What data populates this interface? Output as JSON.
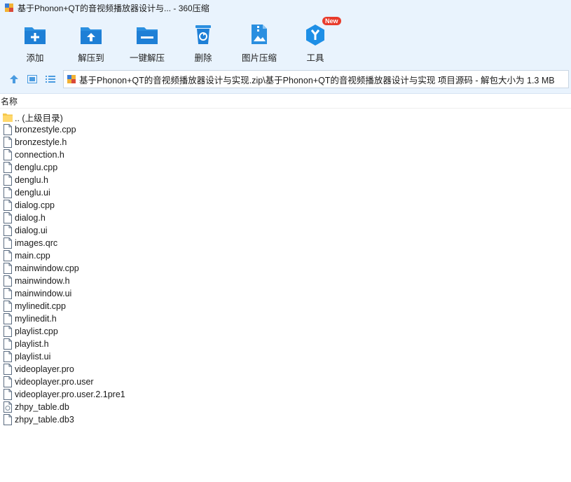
{
  "window": {
    "title": "基于Phonon+QT的音视频播放器设计与... - 360压缩"
  },
  "toolbar": {
    "items": [
      {
        "label": "添加",
        "icon": "add-icon"
      },
      {
        "label": "解压到",
        "icon": "extract-to-icon"
      },
      {
        "label": "一键解压",
        "icon": "one-click-extract-icon"
      },
      {
        "label": "删除",
        "icon": "delete-icon"
      },
      {
        "label": "图片压缩",
        "icon": "image-compress-icon"
      },
      {
        "label": "工具",
        "icon": "tools-icon",
        "badge": "New"
      }
    ]
  },
  "address": {
    "path": "基于Phonon+QT的音视频播放器设计与实现.zip\\基于Phonon+QT的音视频播放器设计与实现 项目源码 - 解包大小为 1.3 MB"
  },
  "list": {
    "header": "名称",
    "parent": ".. (上级目录)",
    "files": [
      {
        "name": "bronzestyle.cpp",
        "type": "file"
      },
      {
        "name": "bronzestyle.h",
        "type": "file"
      },
      {
        "name": "connection.h",
        "type": "file"
      },
      {
        "name": "denglu.cpp",
        "type": "file"
      },
      {
        "name": "denglu.h",
        "type": "file"
      },
      {
        "name": "denglu.ui",
        "type": "file"
      },
      {
        "name": "dialog.cpp",
        "type": "file"
      },
      {
        "name": "dialog.h",
        "type": "file"
      },
      {
        "name": "dialog.ui",
        "type": "file"
      },
      {
        "name": "images.qrc",
        "type": "file"
      },
      {
        "name": "main.cpp",
        "type": "file"
      },
      {
        "name": "mainwindow.cpp",
        "type": "file"
      },
      {
        "name": "mainwindow.h",
        "type": "file"
      },
      {
        "name": "mainwindow.ui",
        "type": "file"
      },
      {
        "name": "mylinedit.cpp",
        "type": "file"
      },
      {
        "name": "mylinedit.h",
        "type": "file"
      },
      {
        "name": "playlist.cpp",
        "type": "file"
      },
      {
        "name": "playlist.h",
        "type": "file"
      },
      {
        "name": "playlist.ui",
        "type": "file"
      },
      {
        "name": "videoplayer.pro",
        "type": "file"
      },
      {
        "name": "videoplayer.pro.user",
        "type": "file"
      },
      {
        "name": "videoplayer.pro.user.2.1pre1",
        "type": "file"
      },
      {
        "name": "zhpy_table.db",
        "type": "db"
      },
      {
        "name": "zhpy_table.db3",
        "type": "file"
      }
    ]
  },
  "colors": {
    "chrome": "#e9f3fd",
    "accent": "#2b8fe0",
    "badge": "#e83b2b"
  }
}
